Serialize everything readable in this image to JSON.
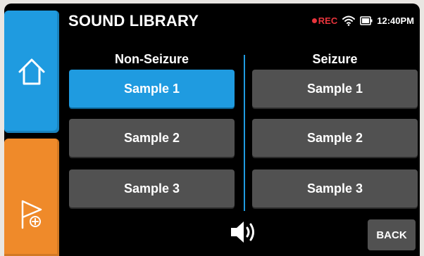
{
  "header": {
    "title": "SOUND LIBRARY",
    "rec_label": "REC",
    "time": "12:40PM"
  },
  "sidebar": {
    "home_icon": "home-icon",
    "flag_icon": "flag-add-icon"
  },
  "columns": {
    "non_seizure": {
      "heading": "Non-Seizure",
      "samples": [
        "Sample 1",
        "Sample 2",
        "Sample 3"
      ],
      "selected_index": 0
    },
    "seizure": {
      "heading": "Seizure",
      "samples": [
        "Sample 1",
        "Sample 2",
        "Sample 3"
      ]
    }
  },
  "footer": {
    "speaker_icon": "speaker-icon",
    "back_label": "BACK"
  },
  "colors": {
    "accent_blue": "#1f9be0",
    "accent_orange": "#ef8a2a",
    "button_gray": "#515151",
    "rec_red": "#e8343c"
  }
}
